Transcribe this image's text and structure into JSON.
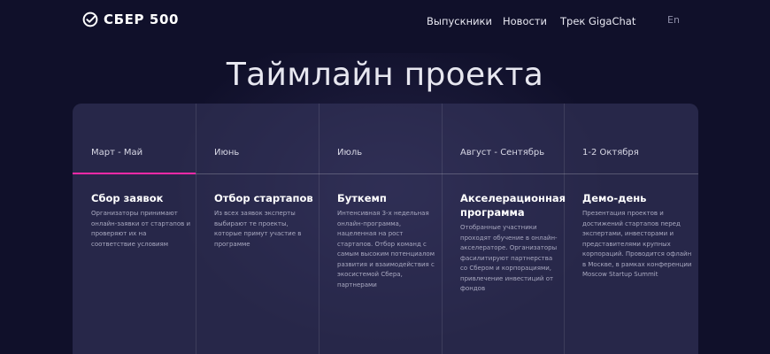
{
  "header": {
    "logo_text": "СБЕР 500",
    "nav": [
      "Выпускники",
      "Новости",
      "Трек GigaChat"
    ],
    "lang": "En"
  },
  "title": "Таймлайн проекта",
  "timeline": [
    {
      "period": "Март - Май",
      "stage": "Сбор заявок",
      "description": "Организаторы принимают онлайн-заявки от стартапов и проверяют их на соответствие условиям"
    },
    {
      "period": "Июнь",
      "stage": "Отбор стартапов",
      "description": "Из всех заявок эксперты выбирают те проекты, которые примут участие в программе"
    },
    {
      "period": "Июль",
      "stage": "Буткемп",
      "description": "Интенсивная 3-х недельная онлайн-программа, нацеленная на рост стартапов. Отбор команд с самым высоким потенциалом развития и взаимодействия с экосистемой Сбера, партнерами"
    },
    {
      "period": "Август - Сентябрь",
      "stage": "Акселерационная программа",
      "description": "Отобранные участники проходят обучение в онлайн-акселераторе. Организаторы фасилитируют партнерства со Сбером и корпорациями, привлечение инвестиций от фондов"
    },
    {
      "period": "1-2 Октября",
      "stage": "Демо-день",
      "description": "Презентация проектов и достижений стартапов перед экспертами, инвесторами и представителями крупных корпораций. Проводится офлайн в Москве, в рамках конференции Moscow Startup Summit"
    }
  ],
  "colors": {
    "background": "#10102a",
    "card": "#3a3a62",
    "accent": "#ff2aa8"
  },
  "icons": {
    "logo": "check-circle-icon"
  }
}
